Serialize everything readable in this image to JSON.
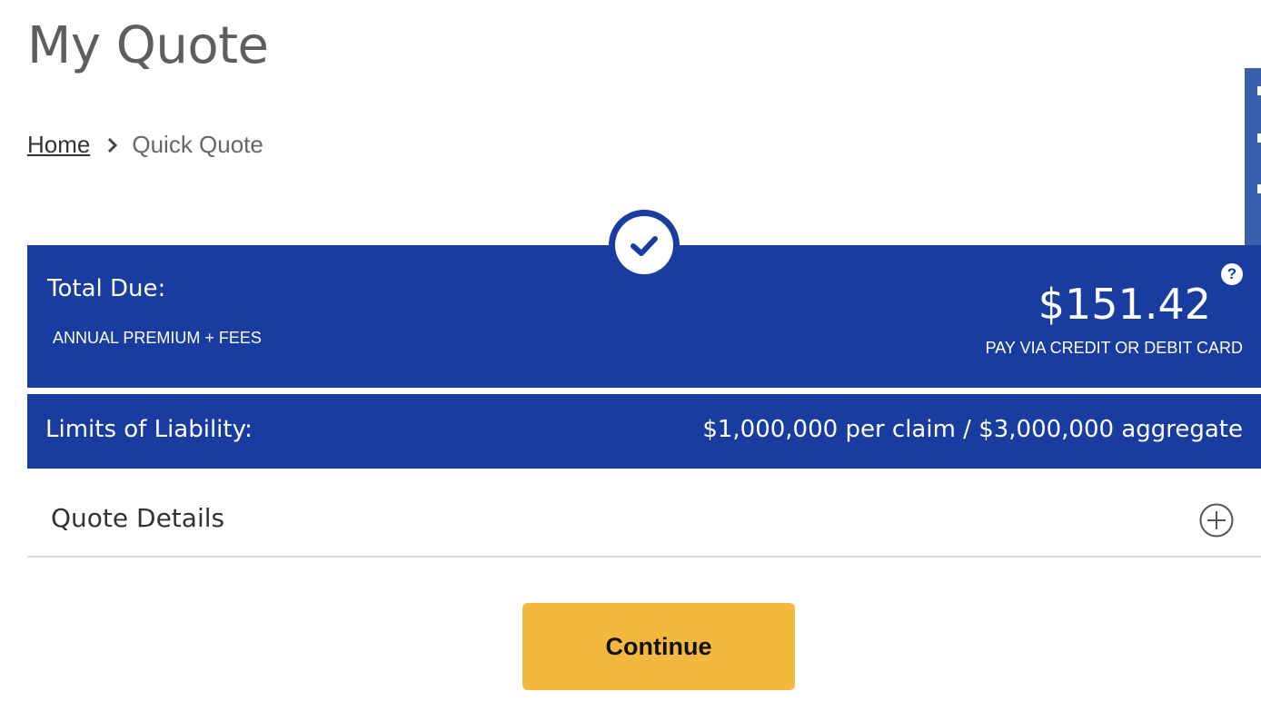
{
  "page": {
    "title": "My Quote"
  },
  "breadcrumb": {
    "home": "Home",
    "current": "Quick Quote"
  },
  "total": {
    "label": "Total Due:",
    "sub_label": "ANNUAL PREMIUM + FEES",
    "amount": "$151.42",
    "payment_note": "PAY VIA CREDIT OR DEBIT CARD",
    "help": "?"
  },
  "liability": {
    "label": "Limits of Liability:",
    "value": "$1,000,000 per claim / $3,000,000 aggregate"
  },
  "details": {
    "label": "Quote Details"
  },
  "actions": {
    "continue_label": "Continue"
  },
  "colors": {
    "brand_blue": "#183c9f",
    "button_yellow": "#f4b83f",
    "title_gray": "#5e5e5e"
  },
  "icons": {
    "breadcrumb_separator": "chevron-right-icon",
    "status": "check-icon",
    "help": "question-icon",
    "expand": "plus-circle-icon"
  }
}
